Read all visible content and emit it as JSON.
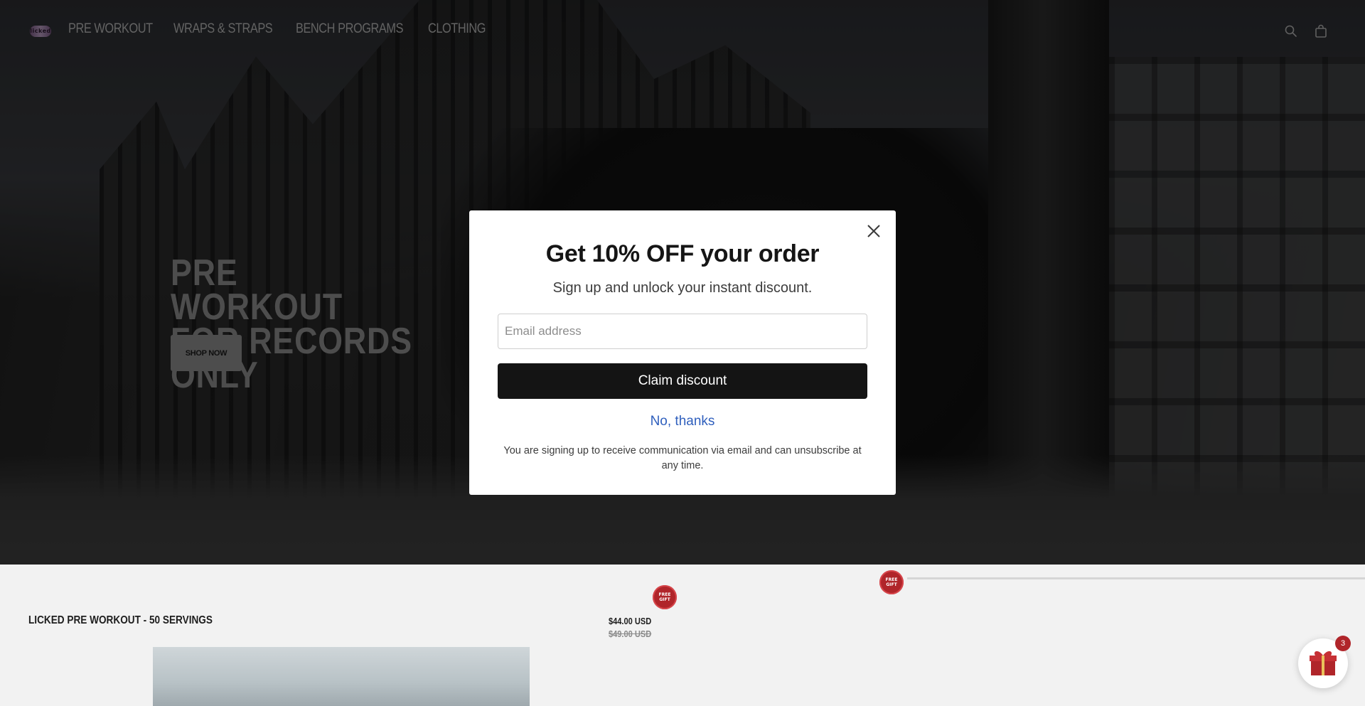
{
  "header": {
    "logo_text": "licked",
    "nav": [
      "PRE WORKOUT",
      "WRAPS & STRAPS",
      "BENCH PROGRAMS",
      "CLOTHING"
    ],
    "icons": [
      "search-icon",
      "cart-icon"
    ]
  },
  "hero": {
    "title": "PRE WORKOUT FOR RECORDS ONLY",
    "cta": "SHOP NOW"
  },
  "product": {
    "title": "LICKED PRE WORKOUT - 50 SERVINGS",
    "price": "$44.00 USD",
    "compare_price": "$49.00 USD",
    "badge": "FREE GIFT"
  },
  "popup": {
    "heading": "Get 10% OFF your order",
    "subheading": "Sign up and unlock your instant discount.",
    "email_placeholder": "Email address",
    "claim_label": "Claim discount",
    "decline_label": "No, thanks",
    "disclaimer": "You are signing up to receive communication via email and can unsubscribe at any time."
  },
  "gift_widget": {
    "count": "3"
  },
  "colors": {
    "accent_red": "#b0252a",
    "button_dark": "#141414",
    "link_blue": "#2f5fbd"
  }
}
